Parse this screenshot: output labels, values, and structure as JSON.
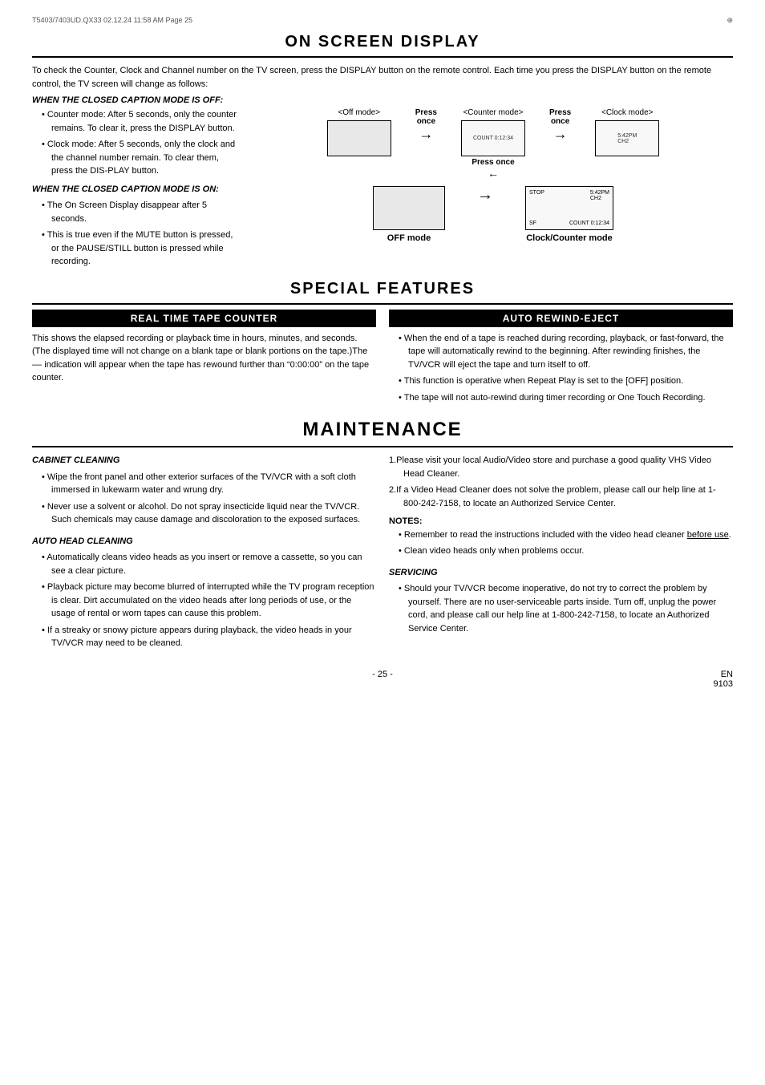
{
  "page": {
    "header": {
      "file_info": "T5403/7403UD.QX33  02.12.24  11:58 AM  Page 25"
    },
    "footer": {
      "page_number": "- 25 -",
      "lang": "EN",
      "code": "9103"
    }
  },
  "on_screen_display": {
    "title": "ON SCREEN DISPLAY",
    "intro": "To check the Counter, Clock and Channel number on the TV screen, press the DISPLAY button on the remote control. Each time you press the DISPLAY button on the remote control, the TV screen will change as follows:",
    "caption_off_heading": "WHEN THE CLOSED CAPTION MODE IS OFF:",
    "bullets_left": [
      "Counter mode: After 5 seconds, only the counter remains. To clear it, press the DISPLAY button.",
      "Clock mode: After 5 seconds, only the clock and the channel number remain. To clear them, press the DIS-PLAY button."
    ],
    "diagram": {
      "off_mode_label": "<Off mode>",
      "counter_mode_label": "<Counter mode>",
      "clock_mode_label": "<Clock mode>",
      "press_once_1": "Press\nonce",
      "press_once_2": "Press\nonce",
      "press_once_bottom": "Press once",
      "counter_display": "COUNT  0:12:34",
      "clock_display": "5:42PM\nCH2",
      "off_mode_bottom_label": "OFF mode",
      "clock_counter_mode_label": "Clock/Counter mode",
      "caption_on_screen_stop": "STOP",
      "caption_on_screen_time": "5:42PM\nCH2",
      "caption_on_screen_sf": "SF",
      "caption_on_screen_count": "COUNT  0:12:34"
    },
    "caption_on_heading": "WHEN THE CLOSED CAPTION MODE IS ON:",
    "caption_on_bullets": [
      "The On Screen Display disappear after 5 seconds.",
      "This is true even if the MUTE button is pressed, or the PAUSE/STILL button is pressed while recording."
    ]
  },
  "special_features": {
    "title": "SPECIAL FEATURES",
    "real_time_tape_counter": {
      "header": "REAL TIME TAPE COUNTER",
      "content": "This shows the elapsed recording or playback time in hours, minutes, and seconds. (The displayed time will not change on a blank tape or blank portions on the tape.)The –– indication will appear when the tape has rewound further than “0:00:00” on the tape counter."
    },
    "auto_rewind_eject": {
      "header": "AUTO REWIND-EJECT",
      "bullets": [
        "When the end of a tape is reached during recording, playback, or fast-forward, the tape will automatically rewind to the beginning. After rewinding finishes, the TV/VCR will eject the tape and turn itself to off.",
        "This function is operative when Repeat Play is set to the [OFF] position.",
        "The tape will not auto-rewind during timer recording or One Touch Recording."
      ]
    }
  },
  "maintenance": {
    "title": "MAINTENANCE",
    "cabinet_cleaning": {
      "heading": "CABINET CLEANING",
      "bullets": [
        "Wipe the front panel and other exterior surfaces of the TV/VCR with a soft cloth immersed in lukewarm water and wrung dry.",
        "Never use a solvent or alcohol. Do not spray insecticide liquid near the TV/VCR. Such chemicals may cause damage and discoloration to the exposed surfaces."
      ]
    },
    "auto_head_cleaning": {
      "heading": "AUTO HEAD CLEANING",
      "bullets": [
        "Automatically cleans video heads as you insert or remove a cassette, so you can see a clear picture.",
        "Playback picture may become blurred of interrupted while the TV program reception is clear. Dirt accumulated on the video heads after long periods of use, or the usage of rental or worn tapes can cause this problem.",
        "If a streaky or snowy picture appears during playback, the video heads in your TV/VCR may need to be cleaned."
      ]
    },
    "right_col": {
      "numbered_list": [
        "Please visit your local Audio/Video store and purchase a good quality VHS Video Head Cleaner.",
        "If a Video Head Cleaner does not solve the problem, please call our help line at 1-800-242-7158, to locate an Authorized Service Center."
      ],
      "notes_heading": "NOTES:",
      "notes_bullets": [
        "Remember to read the instructions included with the video head cleaner before use.",
        "Clean video heads only when problems occur."
      ]
    },
    "servicing": {
      "heading": "SERVICING",
      "content": "Should your TV/VCR become inoperative, do not try to correct the problem by yourself. There are no user-serviceable parts inside. Turn off, unplug the power cord, and please call our help line at 1-800-242-7158, to locate an Authorized Service Center."
    }
  }
}
